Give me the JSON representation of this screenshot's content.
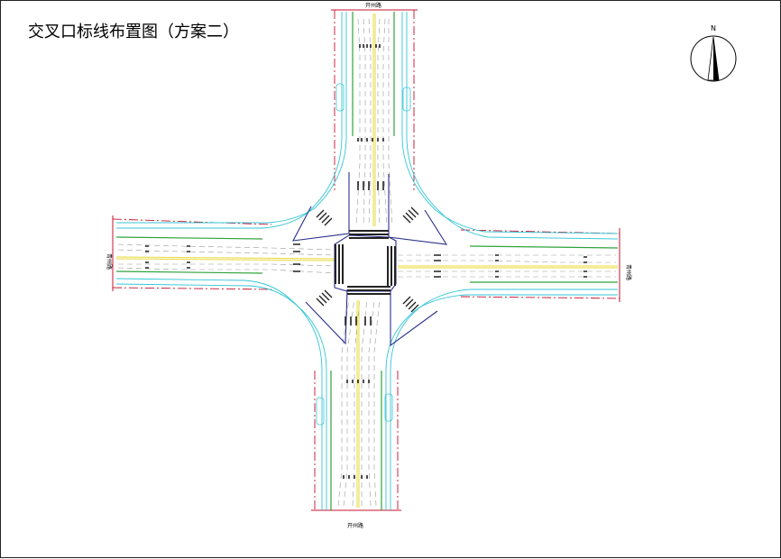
{
  "title": "交叉口标线布置图（方案二）",
  "road_labels": {
    "north": "开州路",
    "south": "开州路",
    "west": "青州路",
    "east": "青州路"
  },
  "compass": {
    "letter": "N"
  },
  "colors": {
    "red_line": "#c8102e",
    "green_line": "#2fa33a",
    "cyan_line": "#34c6d6",
    "blue_line": "#2a2f8c",
    "yellow_line": "#e8d83a",
    "gray_line": "#9a9a9a"
  }
}
